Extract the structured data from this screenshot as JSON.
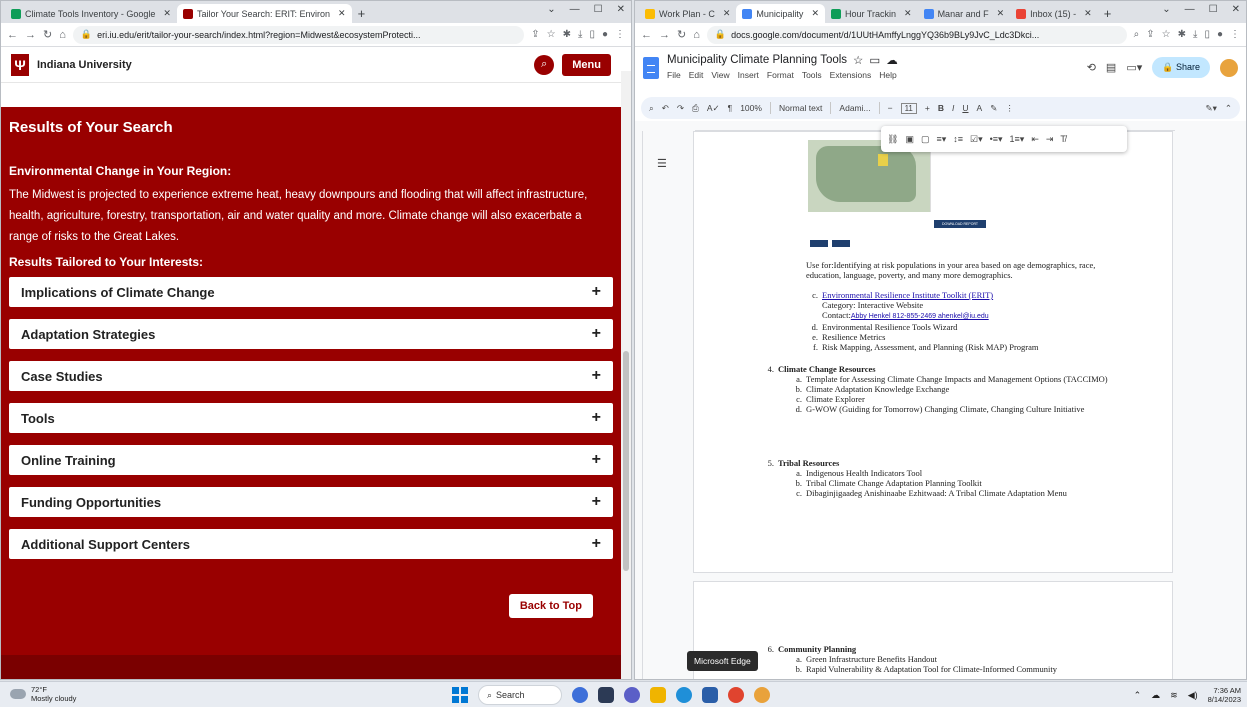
{
  "left_window": {
    "tabs": [
      {
        "label": "Climate Tools Inventory - Google",
        "active": false,
        "fav_color": "#0f9d58"
      },
      {
        "label": "Tailor Your Search: ERIT: Environ",
        "active": true,
        "fav_color": "#990000"
      }
    ],
    "url": "eri.iu.edu/erit/tailor-your-search/index.html?region=Midwest&ecosystemProtecti...",
    "site_name": "Indiana University",
    "trident": "Ψ",
    "menu_label": "Menu",
    "results_title": "Results of Your Search",
    "env_title": "Environmental Change in Your Region:",
    "env_text": "The Midwest is projected to experience extreme heat, heavy downpours and flooding that will affect infrastructure, health, agriculture, forestry, transportation, air and water quality and more. Climate change will also exacerbate a range of risks to the Great Lakes.",
    "tailored_title": "Results Tailored to Your Interests:",
    "accordion": [
      "Implications of Climate Change",
      "Adaptation Strategies",
      "Case Studies",
      "Tools",
      "Online Training",
      "Funding Opportunities",
      "Additional Support Centers"
    ],
    "plus": "+",
    "back_to_top": "Back to Top"
  },
  "right_window": {
    "tabs": [
      {
        "label": "Work Plan - C",
        "fav_color": "#fbbc04"
      },
      {
        "label": "Municipality",
        "fav_color": "#4285f4",
        "active": true
      },
      {
        "label": "Hour Trackin",
        "fav_color": "#0f9d58"
      },
      {
        "label": "Manar and F",
        "fav_color": "#4285f4"
      },
      {
        "label": "Inbox (15) -",
        "fav_color": "#ea4335"
      }
    ],
    "url": "docs.google.com/document/d/1UUtHAmffyLnggYQ36b9BLy9JvC_Ldc3Dkci...",
    "doc_title": "Municipality Climate Planning Tools",
    "menus": [
      "File",
      "Edit",
      "View",
      "Insert",
      "Format",
      "Tools",
      "Extensions",
      "Help"
    ],
    "share_label": "Share",
    "toolbar": {
      "zoom": "100%",
      "style": "Normal text",
      "font": "Adami...",
      "size": "11"
    },
    "use_for": "Use for:Identifying at risk populations in your area based on age demographics, race, education, language, poverty, and many more demographics.",
    "dl_button": "DOWNLOAD REPORT",
    "list_c": "Environmental Resilience Institute Toolkit (ERIT)",
    "category": "Category: Interactive Website",
    "contact_label": "Contact:",
    "contact_value": "Abby Henkel 812-855-2469 ahenkel@iu.edu",
    "list_d": "Environmental Resilience Tools Wizard",
    "list_e": "Resilience Metrics",
    "list_f": "Risk Mapping, Assessment, and Planning (Risk MAP) Program",
    "sec4": {
      "title": "Climate Change Resources",
      "items": [
        "Template for Assessing Climate Change Impacts and Management Options (TACCIMO)",
        "Climate Adaptation Knowledge Exchange",
        "Climate Explorer",
        "G-WOW (Guiding for Tomorrow) Changing Climate, Changing Culture Initiative"
      ]
    },
    "sec5": {
      "title": "Tribal Resources",
      "items": [
        "Indigenous Health Indicators Tool",
        "Tribal Climate Change Adaptation Planning Toolkit",
        "Dibaginjigaadeg Anishinaabe Ezhitwaad: A Tribal Climate Adaptation Menu"
      ]
    },
    "sec6": {
      "title": "Community Planning",
      "items": [
        "Green Infrastructure Benefits Handout",
        "Rapid Vulnerability & Adaptation Tool for Climate-Informed Community"
      ]
    },
    "markers": {
      "c": "c.",
      "d": "d.",
      "e": "e.",
      "f": "f.",
      "n4": "4.",
      "n5": "5.",
      "n6": "6.",
      "a": "a.",
      "b": "b."
    }
  },
  "tooltip": "Microsoft Edge",
  "taskbar": {
    "temp": "72°F",
    "weather": "Mostly cloudy",
    "search": "Search",
    "time": "7:36 AM",
    "date": "8/14/2023"
  }
}
